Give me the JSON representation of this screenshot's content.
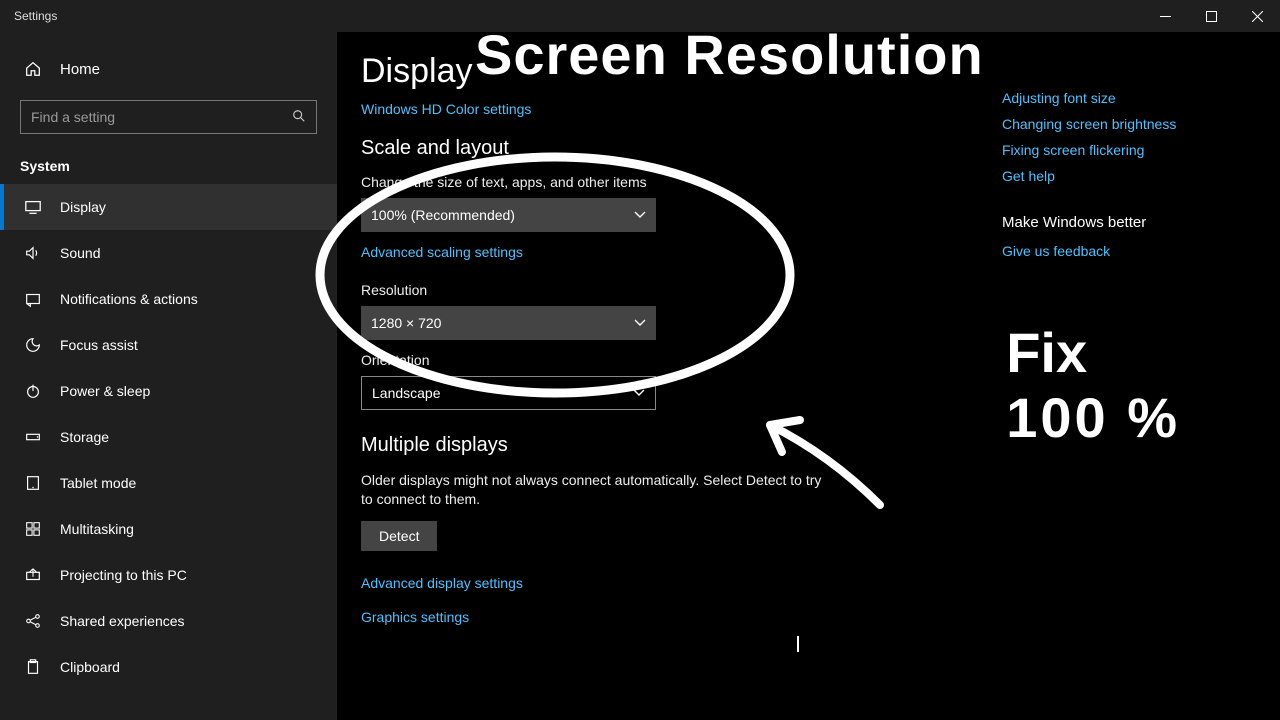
{
  "window": {
    "title": "Settings"
  },
  "sidebar": {
    "home": "Home",
    "search_placeholder": "Find a setting",
    "group": "System",
    "items": [
      {
        "label": "Display"
      },
      {
        "label": "Sound"
      },
      {
        "label": "Notifications & actions"
      },
      {
        "label": "Focus assist"
      },
      {
        "label": "Power & sleep"
      },
      {
        "label": "Storage"
      },
      {
        "label": "Tablet mode"
      },
      {
        "label": "Multitasking"
      },
      {
        "label": "Projecting to this PC"
      },
      {
        "label": "Shared experiences"
      },
      {
        "label": "Clipboard"
      }
    ]
  },
  "main": {
    "page_title": "Display",
    "hd_link": "Windows HD Color settings",
    "scale_title": "Scale and layout",
    "scale_label": "Change the size of text, apps, and other items",
    "scale_value": "100% (Recommended)",
    "advanced_scaling": "Advanced scaling settings",
    "resolution_label": "Resolution",
    "resolution_value": "1280 × 720",
    "orientation_label": "Orientation",
    "orientation_value": "Landscape",
    "multi_title": "Multiple displays",
    "multi_desc": "Older displays might not always connect automatically. Select Detect to try to connect to them.",
    "detect_btn": "Detect",
    "adv_display": "Advanced display settings",
    "graphics": "Graphics settings"
  },
  "right": {
    "links": [
      "Adjusting font size",
      "Changing screen brightness",
      "Fixing screen flickering",
      "Get help"
    ],
    "better_hdr": "Make Windows better",
    "feedback": "Give us feedback"
  },
  "overlay": {
    "title": "Screen Resolution",
    "fix_line1": "Fix",
    "fix_line2": "100 %"
  }
}
